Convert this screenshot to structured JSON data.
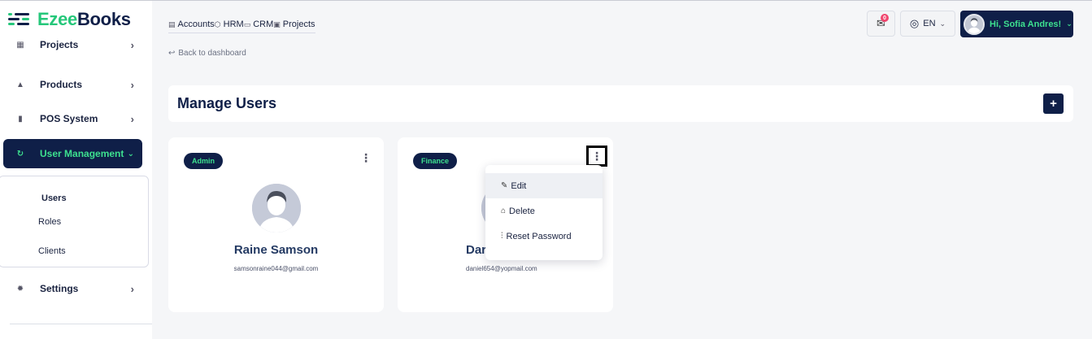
{
  "brand": {
    "part1": "Ezee",
    "part2": "Books"
  },
  "sidebar": {
    "items": [
      {
        "label": "Projects",
        "icon": "building-icon"
      },
      {
        "label": "Products",
        "icon": "boxes-icon"
      },
      {
        "label": "POS System",
        "icon": "pos-terminal-icon"
      },
      {
        "label": "User Management",
        "icon": "users-cycle-icon"
      },
      {
        "label": "Settings",
        "icon": "gear-icon"
      }
    ],
    "submenu": [
      "Users",
      "Roles",
      "Clients"
    ]
  },
  "topbar": {
    "crumbs": [
      "Accounts",
      "HRM",
      "CRM",
      "Projects"
    ],
    "back_label": "Back to dashboard",
    "message_count": "0",
    "language": "EN",
    "greeting": "Hi, Sofia Andres!"
  },
  "page": {
    "title": "Manage Users",
    "add_label": "+"
  },
  "users": [
    {
      "role": "Admin",
      "name": "Raine Samson",
      "email": "samsonraine044@gmail.com"
    },
    {
      "role": "Finance",
      "name": "Dar",
      "email": "daniel654@yopmail.com"
    }
  ],
  "menu": {
    "items": [
      "Edit",
      "Delete",
      "Reset Password"
    ]
  },
  "colors": {
    "navy": "#0f1f48",
    "accent_green": "#3de08f",
    "badge_red": "#f0466e"
  }
}
